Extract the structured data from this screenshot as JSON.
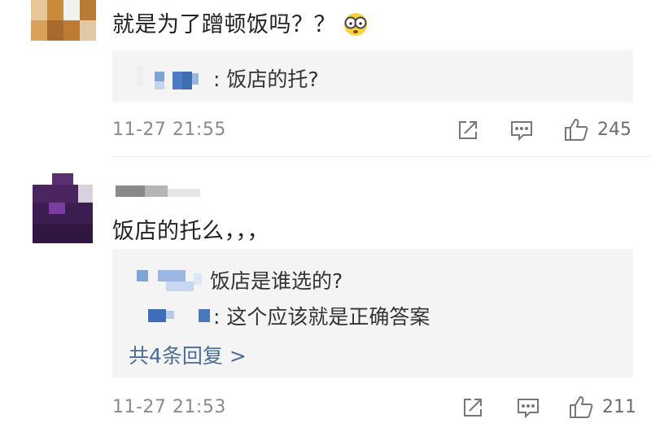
{
  "comments": [
    {
      "text": "就是为了蹭顿饭吗？？",
      "emoji": "shocked-glasses-emoji",
      "replies": [
        {
          "name_sep": ":",
          "text": " 饭店的托?"
        }
      ],
      "time": "11-27 21:55",
      "likes": "245"
    },
    {
      "text": "饭店的托么，，，",
      "replies": [
        {
          "name_sep": ":",
          "text": " 饭店是谁选的?"
        },
        {
          "name_sep": ":",
          "text": " 这个应该就是正确答案"
        }
      ],
      "more_replies": "共4条回复 >",
      "time": "11-27 21:53",
      "likes": "211"
    }
  ],
  "icons": {
    "share": "share-icon",
    "comment": "comment-icon",
    "like": "thumbs-up-icon"
  },
  "colors": {
    "reply_box": "#f4f4f4",
    "link": "#4b6d96",
    "meta": "#8b8b8b"
  }
}
